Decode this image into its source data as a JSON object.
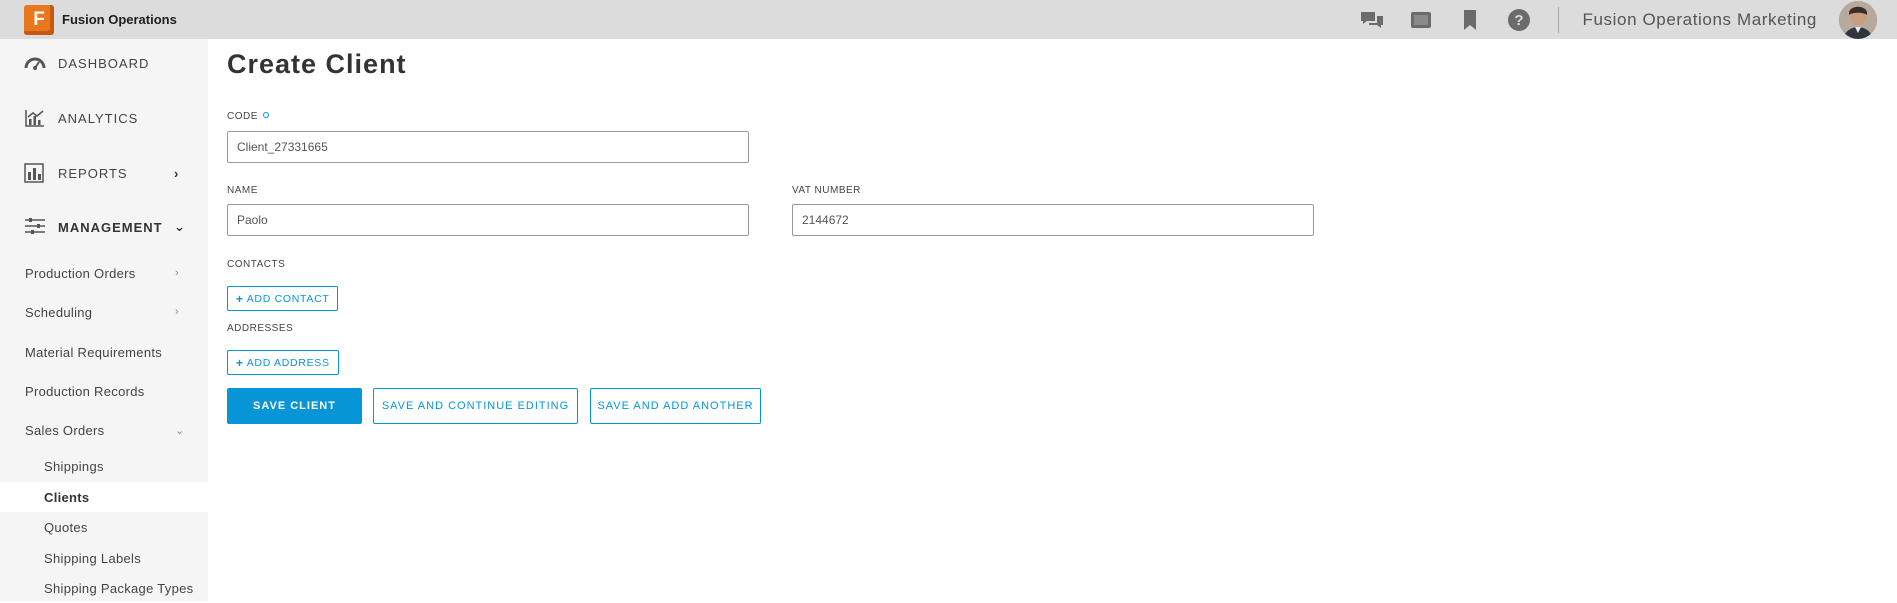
{
  "app": {
    "brand_letter": "F",
    "brand_name": "Fusion Operations",
    "org_name": "Fusion Operations Marketing",
    "icons": [
      "chat-icon",
      "tablet-icon",
      "bookmark-icon",
      "help-icon"
    ],
    "accent_color": "#0696d7",
    "brand_color": "#e8771e"
  },
  "sidebar": {
    "main_items": [
      {
        "label": "DASHBOARD",
        "icon": "gauge-icon"
      },
      {
        "label": "ANALYTICS",
        "icon": "chart-icon"
      },
      {
        "label": "REPORTS",
        "icon": "report-icon",
        "chevron": "›"
      },
      {
        "label": "MANAGEMENT",
        "icon": "sliders-icon",
        "chevron": "⌄"
      }
    ],
    "sub_items": [
      {
        "label": "Production Orders",
        "chevron": "›"
      },
      {
        "label": "Scheduling",
        "chevron": "›"
      },
      {
        "label": "Material Requirements"
      },
      {
        "label": "Production Records"
      },
      {
        "label": "Sales Orders",
        "chevron": "⌄"
      }
    ],
    "leaf_items": [
      {
        "label": "Shippings"
      },
      {
        "label": "Clients",
        "active": true
      },
      {
        "label": "Quotes"
      },
      {
        "label": "Shipping Labels"
      },
      {
        "label": "Shipping Package Types"
      }
    ]
  },
  "form": {
    "title": "Create Client",
    "code": {
      "label": "CODE",
      "value": "Client_27331665"
    },
    "name": {
      "label": "NAME",
      "value": "Paolo"
    },
    "vat": {
      "label": "VAT NUMBER",
      "value": "2144672"
    },
    "contacts": {
      "label": "CONTACTS",
      "button": "ADD CONTACT"
    },
    "addresses": {
      "label": "ADDRESSES",
      "button": "ADD ADDRESS"
    },
    "actions": {
      "save": "SAVE CLIENT",
      "save_continue": "SAVE AND CONTINUE EDITING",
      "save_add": "SAVE AND ADD ANOTHER"
    }
  }
}
